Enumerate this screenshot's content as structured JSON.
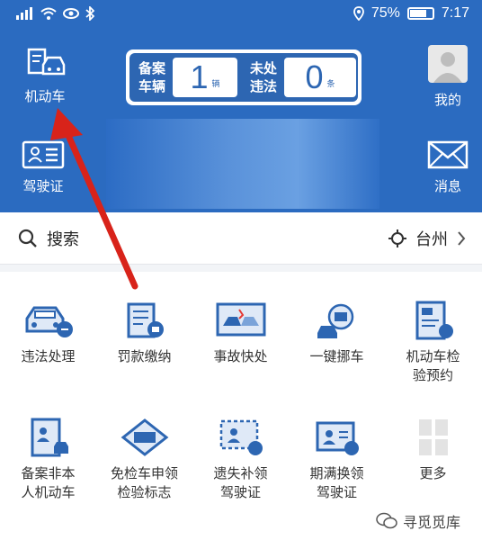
{
  "status_bar": {
    "battery": "75%",
    "time": "7:17"
  },
  "header": {
    "vehicle_label": "机动车",
    "license_label": "驾驶证",
    "profile_label": "我的",
    "messages_label": "消息"
  },
  "stats": {
    "registered": {
      "label_line1": "备案",
      "label_line2": "车辆",
      "value": "1",
      "unit": "辆"
    },
    "violations": {
      "label_line1": "未处",
      "label_line2": "违法",
      "value": "0",
      "unit": "条"
    }
  },
  "search": {
    "label": "搜索",
    "city": "台州"
  },
  "services": [
    {
      "line1": "违法处理",
      "line2": ""
    },
    {
      "line1": "罚款缴纳",
      "line2": ""
    },
    {
      "line1": "事故快处",
      "line2": ""
    },
    {
      "line1": "一键挪车",
      "line2": ""
    },
    {
      "line1": "机动车检",
      "line2": "验预约"
    },
    {
      "line1": "备案非本",
      "line2": "人机动车"
    },
    {
      "line1": "免检车申领",
      "line2": "检验标志"
    },
    {
      "line1": "遗失补领",
      "line2": "驾驶证"
    },
    {
      "line1": "期满换领",
      "line2": "驾驶证"
    },
    {
      "line1": "更多",
      "line2": ""
    }
  ],
  "watermark": "寻觅觅库"
}
